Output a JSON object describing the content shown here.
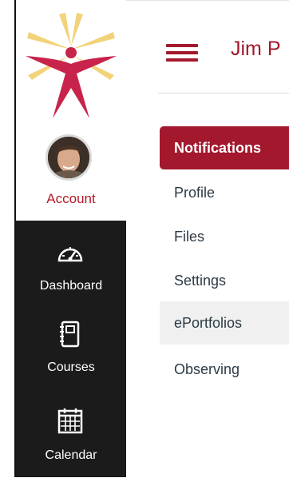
{
  "global_nav": {
    "account_label": "Account",
    "items": [
      {
        "label": "Dashboard",
        "icon": "dashboard-icon"
      },
      {
        "label": "Courses",
        "icon": "courses-icon"
      },
      {
        "label": "Calendar",
        "icon": "calendar-icon"
      }
    ]
  },
  "header": {
    "breadcrumb": "Jim P"
  },
  "section_nav": {
    "items": [
      {
        "label": "Notifications",
        "state": "active"
      },
      {
        "label": "Profile",
        "state": "default"
      },
      {
        "label": "Files",
        "state": "default"
      },
      {
        "label": "Settings",
        "state": "default"
      },
      {
        "label": "ePortfolios",
        "state": "hover"
      },
      {
        "label": "Observing",
        "state": "default"
      }
    ]
  },
  "colors": {
    "brand_red": "#a3182c",
    "nav_dark": "#1b1b1b",
    "logo_yellow": "#f2d37a",
    "logo_pink": "#c8234a"
  }
}
